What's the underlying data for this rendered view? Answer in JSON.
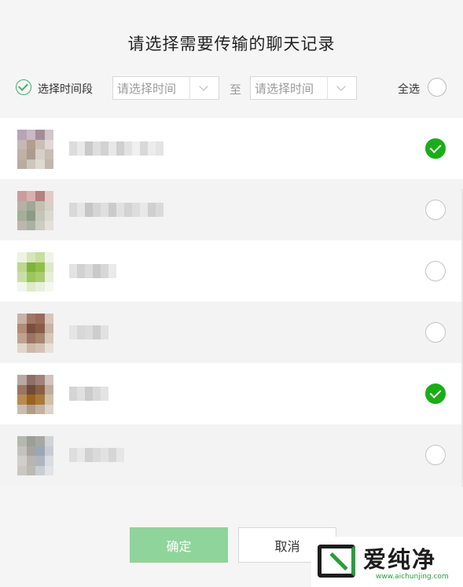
{
  "dialog": {
    "title": "请选择需要传输的聊天记录",
    "filter": {
      "time_range_label": "选择时间段",
      "start_placeholder": "请选择时间",
      "to_label": "至",
      "end_placeholder": "请选择时间",
      "select_all_label": "全选"
    },
    "chats": [
      {
        "checked": true
      },
      {
        "checked": false
      },
      {
        "checked": false
      },
      {
        "checked": false
      },
      {
        "checked": true
      },
      {
        "checked": false
      }
    ],
    "buttons": {
      "confirm": "确定",
      "cancel": "取消"
    }
  },
  "watermark": {
    "brand": "爱纯净",
    "url": "www.aichunjing.com"
  },
  "colors": {
    "accent_green": "#1aad19",
    "confirm_disabled": "#8fd49a"
  }
}
